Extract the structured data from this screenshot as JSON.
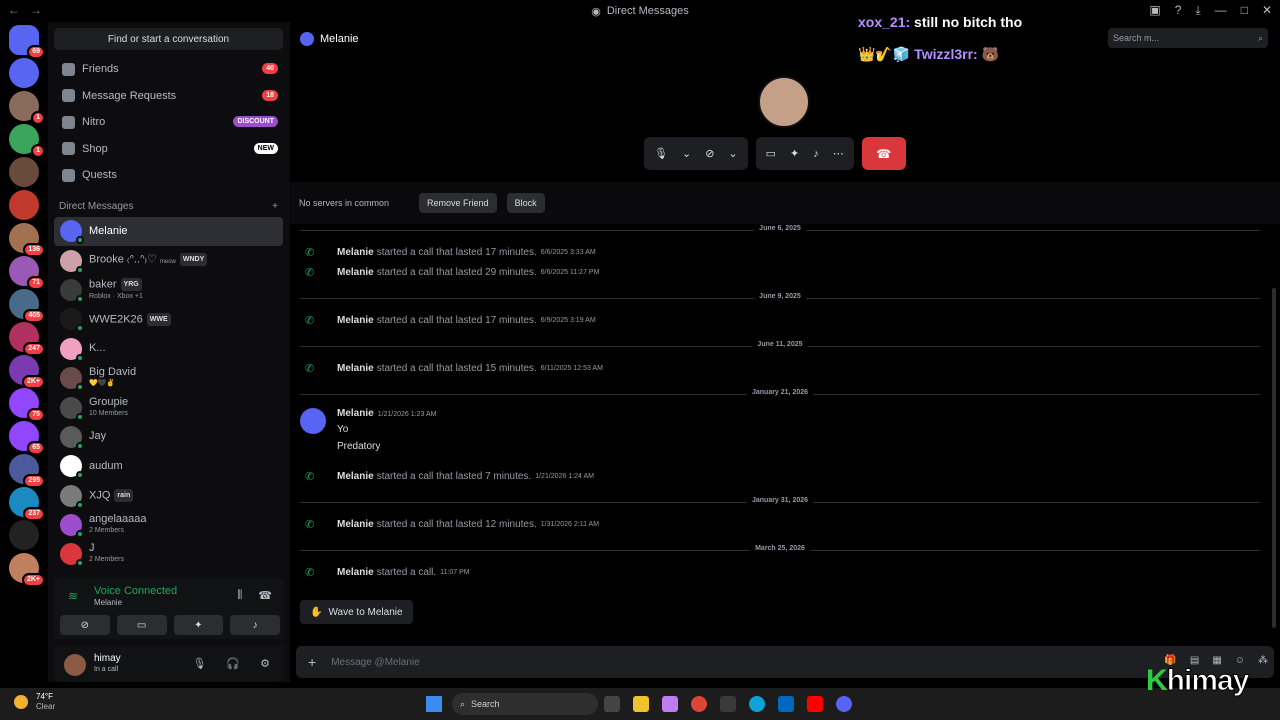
{
  "titlebar": {
    "title": "Direct Messages"
  },
  "servers": [
    {
      "badge": "69"
    },
    {
      "badge": ""
    },
    {
      "badge": "1"
    },
    {
      "badge": "1"
    },
    {
      "badge": ""
    },
    {
      "badge": ""
    },
    {
      "badge": "136"
    },
    {
      "badge": "71"
    },
    {
      "badge": "405"
    },
    {
      "badge": "247"
    },
    {
      "badge": "2K+"
    },
    {
      "badge": "75"
    },
    {
      "badge": "65"
    },
    {
      "badge": "295"
    },
    {
      "badge": "237"
    },
    {
      "badge": ""
    },
    {
      "badge": "2K+"
    }
  ],
  "sidebar": {
    "find_label": "Find or start a conversation",
    "nav": [
      {
        "label": "Friends",
        "pill": "40",
        "pill_color": "#f23f43"
      },
      {
        "label": "Message Requests",
        "pill": "18",
        "pill_color": "#f23f43"
      },
      {
        "label": "Nitro",
        "pill": "DISCOUNT",
        "pill_color": "#9b4dcc"
      },
      {
        "label": "Shop",
        "pill": "NEW",
        "pill_color": "#ffffff"
      },
      {
        "label": "Quests",
        "pill": "",
        "pill_color": ""
      }
    ],
    "dm_header": "Direct Messages",
    "dm_add": "+",
    "dms": [
      {
        "name": "Melanie",
        "sub": "",
        "tag": "",
        "color": "#5865f2"
      },
      {
        "name": "Brooke ₍ᐢ..ᐢ₎♡",
        "sub": "",
        "tag": "WNDY",
        "color": "#d0a0a8",
        "note": "meow"
      },
      {
        "name": "baker",
        "sub": "Roblox · Xbox +1",
        "tag": "YRG",
        "color": "#3a3a3a"
      },
      {
        "name": "WWE2K26",
        "sub": "",
        "tag": "WWE",
        "color": "#1a1a1a"
      },
      {
        "name": "K...",
        "sub": "",
        "tag": "",
        "color": "#f0a0c0"
      },
      {
        "name": "Big David",
        "sub": "💛🖤✌",
        "tag": "",
        "color": "#6a4a4a"
      },
      {
        "name": "Groupie",
        "sub": "10 Members",
        "tag": "",
        "color": "#4a4a4a"
      },
      {
        "name": "Jay",
        "sub": "",
        "tag": "",
        "color": "#5a5a5a"
      },
      {
        "name": "audum",
        "sub": "",
        "tag": "",
        "color": "#ffffff"
      },
      {
        "name": "XJQ",
        "sub": "",
        "tag": "rain",
        "color": "#7a7a7a"
      },
      {
        "name": "angelaaaaa",
        "sub": "2 Members",
        "tag": "",
        "color": "#9b4dcc"
      },
      {
        "name": "J",
        "sub": "2 Members",
        "tag": "",
        "color": "#da373c"
      }
    ],
    "voice": {
      "title": "Voice Connected",
      "sub": "Melanie"
    },
    "user": {
      "name": "himay",
      "status": "In a call"
    }
  },
  "main": {
    "header_name": "Melanie",
    "search_placeholder": "Search m...",
    "overlay_line1_name": "xox_21:",
    "overlay_line1_text": " still no bitch tho",
    "overlay_line2": "👑🎷🧊 Twizzl3rr: 🐻",
    "profile_bar": {
      "no_servers": "No servers in common",
      "remove_friend": "Remove Friend",
      "block": "Block"
    },
    "dividers": [
      "June 6, 2025",
      "June 9, 2025",
      "June 11, 2025",
      "January 21, 2026",
      "January 31, 2026",
      "March 25, 2026"
    ],
    "calls": [
      {
        "name": "Melanie",
        "text": "started a call that lasted 17 minutes.",
        "ts": "6/6/2025 3:33 AM"
      },
      {
        "name": "Melanie",
        "text": "started a call that lasted 29 minutes.",
        "ts": "6/6/2025 11:27 PM"
      },
      {
        "name": "Melanie",
        "text": "started a call that lasted 17 minutes.",
        "ts": "6/9/2025 3:19 AM"
      },
      {
        "name": "Melanie",
        "text": "started a call that lasted 15 minutes.",
        "ts": "6/11/2025 12:53 AM"
      },
      {
        "name": "Melanie",
        "text": "started a call that lasted 7 minutes.",
        "ts": "1/21/2026 1:24 AM"
      },
      {
        "name": "Melanie",
        "text": "started a call that lasted 12 minutes.",
        "ts": "1/31/2026 2:11 AM"
      },
      {
        "name": "Melanie",
        "text": "started a call.",
        "ts": "11:07 PM"
      }
    ],
    "message": {
      "author": "Melanie",
      "ts": "1/21/2026 1:23 AM",
      "lines": [
        "Yo",
        "Predatory"
      ]
    },
    "wave_label": "Wave to Melanie",
    "composer_placeholder": "Message @Melanie"
  },
  "taskbar": {
    "temp": "74°F",
    "cond": "Clear",
    "search": "Search"
  },
  "watermark": {
    "brand": "K",
    "word": "himay"
  }
}
